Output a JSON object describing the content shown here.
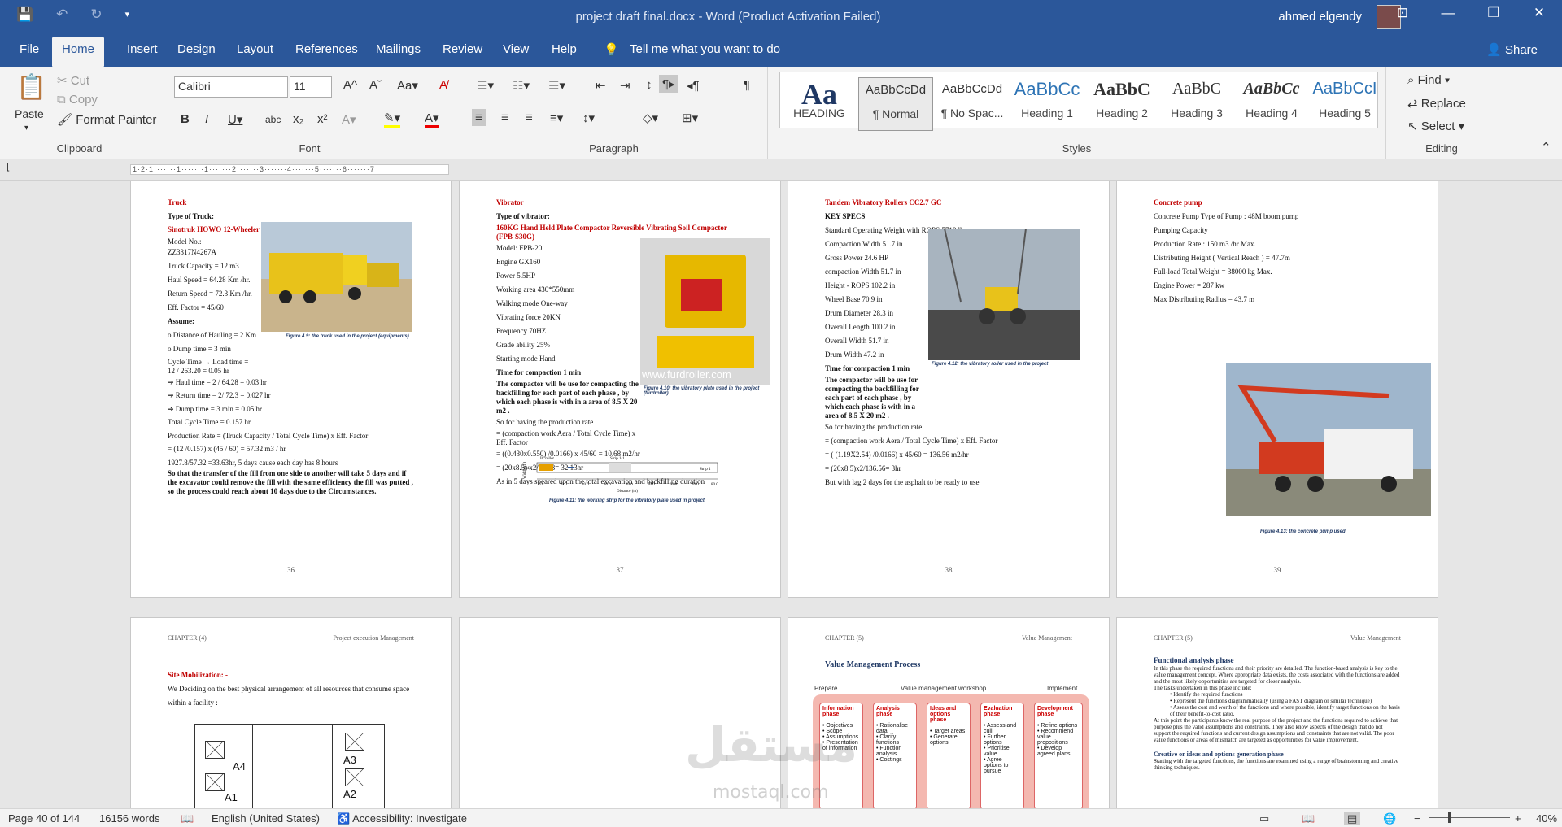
{
  "window": {
    "title": "project draft final.docx  -  Word (Product Activation Failed)",
    "user": "ahmed elgendy",
    "share": "Share"
  },
  "tabs": [
    "File",
    "Home",
    "Insert",
    "Design",
    "Layout",
    "References",
    "Mailings",
    "Review",
    "View",
    "Help"
  ],
  "tell_me": "Tell me what you want to do",
  "clipboard": {
    "paste": "Paste",
    "cut": "Cut",
    "copy": "Copy",
    "format_painter": "Format Painter",
    "label": "Clipboard"
  },
  "font": {
    "name": "Calibri",
    "size": "11",
    "label": "Font"
  },
  "paragraph": {
    "label": "Paragraph"
  },
  "styles": {
    "label": "Styles",
    "items": [
      {
        "preview": "Aa",
        "name": "HEADING"
      },
      {
        "preview": "AaBbCcDd",
        "name": "¶ Normal"
      },
      {
        "preview": "AaBbCcDd",
        "name": "¶ No Spac..."
      },
      {
        "preview": "AaBbCc",
        "name": "Heading 1"
      },
      {
        "preview": "AaBbC",
        "name": "Heading 2"
      },
      {
        "preview": "AaBbC",
        "name": "Heading 3"
      },
      {
        "preview": "AaBbCc",
        "name": "Heading 4"
      },
      {
        "preview": "AaBbCcI",
        "name": "Heading 5"
      }
    ]
  },
  "editing": {
    "find": "Find",
    "replace": "Replace",
    "select": "Select",
    "label": "Editing"
  },
  "ruler_text": "1·2·1·······1·······1·······2·······3·······4·······5·······6·······7",
  "pages": {
    "p36": {
      "heading": "Truck",
      "type_label": "Type of Truck:",
      "model": "Sinotruk HOWO 12-Wheeler 50 Ton Dump Trucks Capacity",
      "lines": [
        "Model No.:",
        "ZZ3317N4267A",
        "Truck Capacity = 12 m3",
        "Haul Speed = 64.28 Km /hr.",
        "Return Speed = 72.3 Km /hr.",
        "Eff. Factor = 45/60"
      ],
      "assume": "Assume:",
      "lines2": [
        "o Distance of Hauling = 2 Km",
        "o Dump time = 3 min",
        "Cycle Time → Load time = 12 / 263.20 = 0.05 hr",
        "➔ Haul time = 2 / 64.28 = 0.03 hr",
        "➔ Return time = 2/ 72.3 = 0.027 hr",
        "➔ Dump time = 3 min = 0.05 hr",
        "Total Cycle Time = 0.157 hr",
        "Production Rate = (Truck Capacity / Total Cycle Time) x Eff. Factor",
        "= (12 /0.157) x (45 / 60) = 57.32 m3 / hr",
        "1927.8/57.32 =33.63hr, 5 days cause each day has 8 hours"
      ],
      "bold_para": "So that the transfer of the fill from one side to another will take 5 days and if the excavator could remove the fill with the same efficiency the fill was putted , so the process could reach about 10 days due to the Circumstances.",
      "caption": "Figure 4.9: the truck used in the project (equipments)",
      "num": "36"
    },
    "p37": {
      "heading": "Vibrator",
      "type_label": "Type of vibrator:",
      "model": "160KG Hand Held Plate Compactor Reversible Vibrating Soil Compactor (FPB-S30G)",
      "lines": [
        "Model: FPB-20",
        "Engine GX160",
        "Power 5.5HP",
        "Working area 430*550mm",
        "Walking mode One-way",
        "Vibrating force 20KN",
        "Frequency 70HZ",
        "Grade ability 25%",
        "Starting mode Hand"
      ],
      "tc": "Time for compaction 1 min",
      "bold_para": "The compactor will be use for compacting the backfilling for each part of each phase , by which each phase is with in a area of 8.5 X 20 m2 .",
      "lines2": [
        "So for having the production rate",
        "= (compaction work Aera / Total Cycle Time) x Eff. Factor",
        "= ((0.430x0.550) /0.0166) x 45/60 = 10.68 m2/hr",
        "= (20x8.5) x2/10.58= 32.13hr",
        "As in 5 days speared upon the total excavation and backfilling duration"
      ],
      "caption": "Figure 4.10: the vibratory plate used in the project (furdroller)",
      "watermark": "www.furdroller.com",
      "fig2": "Figure 4.11: the working strip for the vibratory plate used in project",
      "strip_labels": [
        "IC roller",
        "Strip 1-1",
        "Strip 1"
      ],
      "xaxis": [
        "0.0",
        "10.0",
        "20.0",
        "30.0",
        "40.0",
        "50.0",
        "60.0",
        "70.0",
        "80.0"
      ],
      "xlabel": "Distance (m)",
      "ylabel": "Width (m)",
      "yval": "0.43",
      "num": "37"
    },
    "p38": {
      "heading": "Tandem Vibratory Rollers CC2.7 GC",
      "specs": "KEY SPECS",
      "lines": [
        "Standard Operating Weight with ROPS   5718 lb",
        "Compaction Width 51.7 in",
        "Gross Power 24.6 HP",
        "compaction Width 51.7 in",
        "Height - ROPS      102.2 in",
        "Wheel Base 70.9 in",
        "Drum Diameter      28.3 in",
        "Overall Length      100.2 in",
        "Overall Width       51.7 in",
        "Drum Width   47.2 in"
      ],
      "tc": "Time for compaction 1 min",
      "bold_para": "The compactor will be use for compacting the backfilling for each part of each phase , by which each phase is with in a area of 8.5 X 20 m2 .",
      "lines2": [
        "So for having the production rate",
        "= (compaction work Aera / Total Cycle Time) x Eff. Factor",
        "= ( (1.19X2.54) /0.0166) x 45/60 = 136.56 m2/hr",
        "= (20x8.5)x2/136.56= 3hr",
        "But with lag 2 days for the asphalt to be ready to use"
      ],
      "caption": "Figure 4.12: the vibratory roller used in the project",
      "num": "38"
    },
    "p39": {
      "heading": "Concrete pump",
      "lines": [
        "Concrete Pump Type of Pump : 48M boom pump",
        "  Pumping Capacity",
        "Production Rate : 150 m3 /hr Max.",
        "Distributing Height ( Vertical Reach ) = 47.7m",
        "  Full-load Total Weight = 38000 kg Max.",
        "  Engine Power = 287 kw",
        "Max Distributing Radius = 43.7 m"
      ],
      "caption": "Figure 4.13: the concrete pump used",
      "num": "39"
    },
    "p40": {
      "chapter": "CHAPTER (4)",
      "chapter_title": "Project execution Management",
      "heading": "Site Mobilization: -",
      "text": "We Deciding on the best physical arrangement of all resources that consume space within a facility :",
      "labels": [
        "A4",
        "A1",
        "A3",
        "A2"
      ]
    },
    "p42": {
      "chapter": "CHAPTER (5)",
      "chapter_title": "Value Management",
      "heading": "Value Management Process",
      "top": [
        "Prepare",
        "Value management workshop",
        "Implement"
      ],
      "phases": [
        {
          "t": "Information phase",
          "items": [
            "Objectives",
            "Scope",
            "Assumptions",
            "Presentation of information"
          ]
        },
        {
          "t": "Analysis phase",
          "items": [
            "Rationalise data",
            "Clarify functions",
            "Function analysis",
            "Costings"
          ]
        },
        {
          "t": "Ideas and options phase",
          "items": [
            "Target areas",
            "Generate options"
          ]
        },
        {
          "t": "Evaluation phase",
          "items": [
            "Assess and cull",
            "Further options",
            "Prioritise value",
            "Agree options to pursue"
          ]
        },
        {
          "t": "Development phase",
          "items": [
            "Refine options",
            "Recommend value propositions",
            "Develop agreed plans"
          ]
        }
      ]
    },
    "p43": {
      "chapter": "CHAPTER (5)",
      "chapter_title": "Value Management",
      "heading": "Functional analysis phase",
      "para": "In this phase the required functions and their priority are detailed. The function-based analysis is key to the value management concept. Where appropriate data exists, the costs associated with the functions are added and the most likely opportunities are targeted for closer analysis.",
      "tasks": "The tasks undertaken in this phase include:",
      "bullets": [
        "Identify the required functions",
        "Represent the functions diagrammatically (using a FAST diagram or similar technique)",
        "Assess the cost and worth of the functions and where possible, identify target functions on the basis of their benefit-to-cost ratio."
      ],
      "para2": "At this point the participants know the real purpose of the project and the functions required to achieve that purpose plus the valid assumptions and constraints. They also know aspects of the design that do not support the required functions and current design assumptions and constraints that are not valid. The poor value functions or areas of mismatch are targeted as opportunities for value improvement.",
      "heading2": "Creative or ideas and options generation phase",
      "para3": "Starting with the targeted functions, the functions are examined using a range of brainstorming and creative thinking techniques."
    }
  },
  "status": {
    "page": "Page 40 of 144",
    "words": "16156 words",
    "lang": "English (United States)",
    "access": "Accessibility: Investigate",
    "zoom": "40%"
  },
  "watermark": "mostaql.com"
}
